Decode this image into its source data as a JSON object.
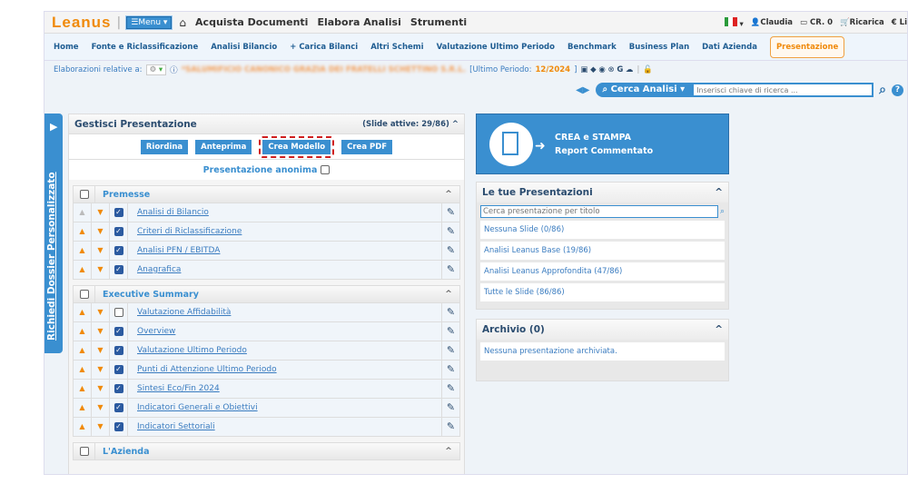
{
  "topbar": {
    "logo": "Leanus",
    "menu": "☰Menu ▾",
    "links": [
      "Acquista Documenti",
      "Elabora Analisi",
      "Strumenti"
    ],
    "user": "Claudia",
    "credits": "CR. 0",
    "recharge": "Ricarica",
    "extra": "€ Li"
  },
  "nav": [
    "Home",
    "Fonte e Riclassificazione",
    "Analisi Bilancio",
    "+ Carica Bilanci",
    "Altri Schemi",
    "Valutazione Ultimo Periodo",
    "Benchmark",
    "Business Plan",
    "Dati Azienda",
    "Presentazione"
  ],
  "info": {
    "label": "Elaborazioni relative a:",
    "company": "*SALUMIFICIO CANONICO GRAZIA DEI FRATELLI SCHETTINO S.R.L.",
    "period_label": "[Ultimo Periodo:",
    "period": "12/2024",
    "close": "]"
  },
  "search": {
    "button": "Cerca Analisi ▾",
    "placeholder": "Inserisci chiave di ricerca ..."
  },
  "sidetab": "Richiedi Dossier Personalizzato",
  "panel": {
    "title": "Gestisci Presentazione",
    "active": "(Slide attive: 29/86)",
    "buttons": [
      "Riordina",
      "Anteprima",
      "Crea Modello",
      "Crea PDF"
    ],
    "anon": "Presentazione anonima",
    "sections": [
      {
        "name": "Premesse",
        "items": [
          {
            "label": "Analisi di Bilancio",
            "checked": true,
            "first": true
          },
          {
            "label": "Criteri di Riclassificazione",
            "checked": true
          },
          {
            "label": "Analisi PFN / EBITDA",
            "checked": true
          },
          {
            "label": "Anagrafica",
            "checked": true
          }
        ]
      },
      {
        "name": "Executive Summary",
        "items": [
          {
            "label": "Valutazione Affidabilità",
            "checked": false
          },
          {
            "label": "Overview",
            "checked": true
          },
          {
            "label": "Valutazione Ultimo Periodo",
            "checked": true
          },
          {
            "label": "Punti di Attenzione Ultimo Periodo",
            "checked": true
          },
          {
            "label": "Sintesi Eco/Fin 2024",
            "checked": true
          },
          {
            "label": "Indicatori Generali e Obiettivi",
            "checked": true
          },
          {
            "label": "Indicatori Settoriali",
            "checked": true
          }
        ]
      },
      {
        "name": "L'Azienda",
        "items": []
      }
    ]
  },
  "banner": {
    "line1": "CREA e STAMPA",
    "line2": "Report Commentato"
  },
  "presentations": {
    "title": "Le tue Presentazioni",
    "placeholder": "Cerca presentazione per titolo",
    "items": [
      "Nessuna Slide (0/86)",
      "Analisi Leanus Base (19/86)",
      "Analisi Leanus Approfondita (47/86)",
      "Tutte le Slide (86/86)"
    ]
  },
  "archive": {
    "title": "Archivio (0)",
    "empty": "Nessuna presentazione archiviata."
  },
  "colors": {
    "accent": "#3a8fd0",
    "brand": "#f08a0b",
    "highlight": "#d01f1f"
  }
}
